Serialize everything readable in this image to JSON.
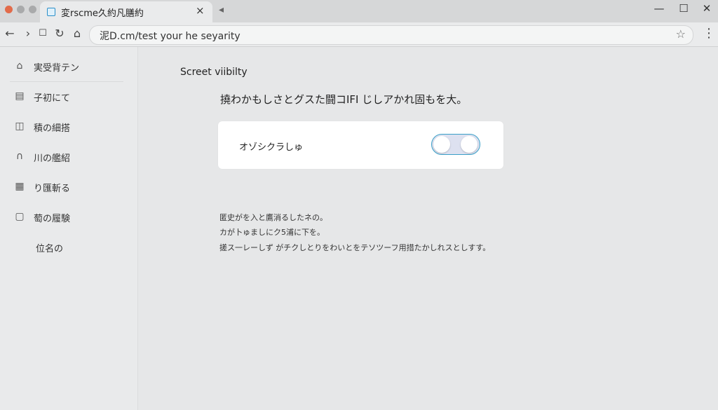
{
  "browser": {
    "tab_title": "変rscme久約凡膳約",
    "tab_close": "×",
    "new_tab": "◂",
    "window_controls": {
      "minimize": "—",
      "maximize": "☐",
      "close": "✕"
    },
    "nav": {
      "back": "←",
      "forward": "›",
      "stop": "☐",
      "reload": "↻",
      "home": "⌂"
    },
    "url": "泥D.cm/test your he seyarity",
    "star": "☆",
    "menu": "⋮",
    "traffic_lights": [
      "#e26b4a",
      "#a9aaab",
      "#a9aaab"
    ]
  },
  "sidebar": {
    "items": [
      {
        "icon": "home-icon",
        "glyph": "⌂",
        "label": "実受背テン"
      },
      {
        "icon": "calendar-icon",
        "glyph": "▤",
        "label": "子初にて"
      },
      {
        "icon": "panel-icon",
        "glyph": "◫",
        "label": "積の細搭"
      },
      {
        "icon": "door-icon",
        "glyph": "∩",
        "label": "川の艦紹"
      },
      {
        "icon": "grid-icon",
        "glyph": "▦",
        "label": "り匯斬る"
      },
      {
        "icon": "briefcase-icon",
        "glyph": "▢",
        "label": "萄の履験"
      },
      {
        "icon": "",
        "glyph": "",
        "label": "位名の"
      }
    ]
  },
  "main": {
    "title": "Screet viibilty",
    "description": "撓わかもしさとグスた闘コIFI じしアかれ固もを大。",
    "card": {
      "label": "オゾシクラしゅ",
      "toggle_on": false
    },
    "notes": [
      "匿史がを入と鷹消るしたネの。",
      "カが卜ゅましにク5浦に下を。",
      "搓ス一レーしず がチクしとりをわいとをテソツーフ用措たかしれスとしすす。"
    ]
  },
  "colors": {
    "accent": "#3aa0c8",
    "favicon": "#2a8fc9"
  }
}
